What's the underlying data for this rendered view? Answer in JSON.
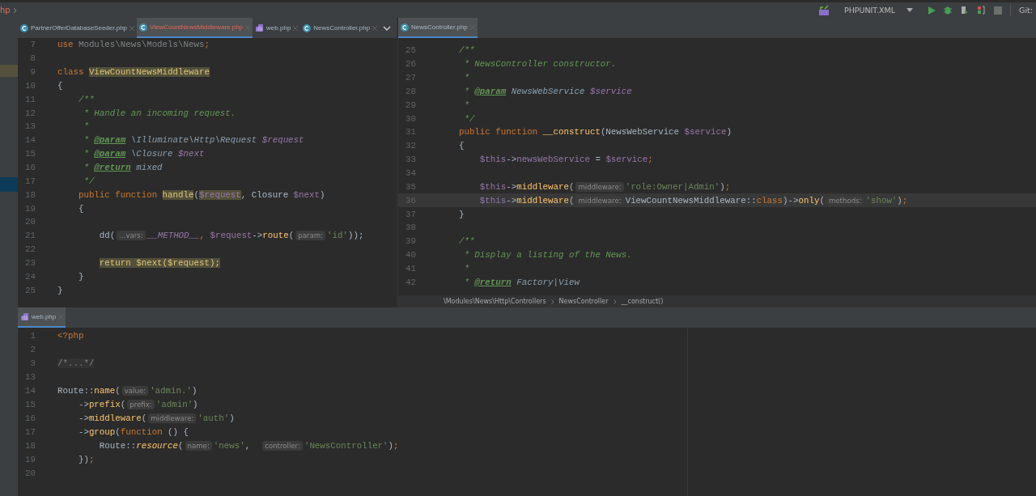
{
  "breadcrumb_top": {
    "text": "hp"
  },
  "toolbar": {
    "run_config": "PHPUNIT.XML",
    "vcs": "Git:"
  },
  "left_editor": {
    "tabs": [
      {
        "label": "PartnerOfferDatabaseSeeder.php",
        "kind": "class",
        "selected": false,
        "error": false
      },
      {
        "label": "ViewCountNewsMiddleware.php",
        "kind": "class",
        "selected": true,
        "error": true
      },
      {
        "label": "web.php",
        "kind": "routes",
        "selected": false,
        "error": false
      },
      {
        "label": "NewsController.php",
        "kind": "class",
        "selected": false,
        "error": false
      }
    ],
    "lines": [
      {
        "num": "7",
        "tokens": [
          {
            "text": "use",
            "kind": "keyword"
          },
          {
            "text": " Modules\\News\\Models\\News",
            "kind": "dim"
          },
          {
            "text": ";",
            "kind": "keyword"
          }
        ]
      },
      {
        "num": "8"
      },
      {
        "num": "9",
        "tokens": [
          {
            "text": "class ",
            "kind": "keyword"
          },
          {
            "text": "ViewCountNewsMiddleware",
            "kind": "mark"
          }
        ]
      },
      {
        "num": "10",
        "tokens": [
          {
            "text": "{",
            "kind": "plain"
          }
        ]
      },
      {
        "num": "11",
        "tokens": [
          {
            "text": "    /**",
            "kind": "comment"
          }
        ]
      },
      {
        "num": "12",
        "tokens": [
          {
            "text": "     * Handle an incoming request.",
            "kind": "comment"
          }
        ]
      },
      {
        "num": "13",
        "tokens": [
          {
            "text": "     *",
            "kind": "comment"
          }
        ]
      },
      {
        "num": "14",
        "tokens": [
          {
            "text": "     * ",
            "kind": "comment"
          },
          {
            "text": "@param",
            "kind": "tag"
          },
          {
            "text": " \\Illuminate\\Http\\Request",
            "kind": "type"
          },
          {
            "text": " $request",
            "kind": "ivar"
          }
        ]
      },
      {
        "num": "15",
        "tokens": [
          {
            "text": "     * ",
            "kind": "comment"
          },
          {
            "text": "@param",
            "kind": "tag"
          },
          {
            "text": " \\Closure",
            "kind": "type"
          },
          {
            "text": " $next",
            "kind": "ivar"
          }
        ]
      },
      {
        "num": "16",
        "tokens": [
          {
            "text": "     * ",
            "kind": "comment"
          },
          {
            "text": "@return",
            "kind": "tag"
          },
          {
            "text": " mixed",
            "kind": "type"
          }
        ]
      },
      {
        "num": "17",
        "tokens": [
          {
            "text": "     */",
            "kind": "comment"
          }
        ]
      },
      {
        "num": "18",
        "tokens": [
          {
            "text": "    public function ",
            "kind": "keyword"
          },
          {
            "text": "handle",
            "kind": "mark"
          },
          {
            "text": "(",
            "kind": "plain"
          },
          {
            "text": "$request",
            "kind": "markvar"
          },
          {
            "text": ", Closure ",
            "kind": "plain"
          },
          {
            "text": "$next",
            "kind": "var"
          },
          {
            "text": ")",
            "kind": "plain"
          }
        ]
      },
      {
        "num": "19",
        "tokens": [
          {
            "text": "    {",
            "kind": "plain"
          }
        ]
      },
      {
        "num": "20"
      },
      {
        "num": "21",
        "tokens": [
          {
            "text": "        dd(",
            "kind": "plain"
          },
          {
            "text": "...vars:",
            "kind": "hint"
          },
          {
            "text": "__METHOD__",
            "kind": "const"
          },
          {
            "text": ", ",
            "kind": "keyword"
          },
          {
            "text": "$request",
            "kind": "var"
          },
          {
            "text": "->",
            "kind": "plain"
          },
          {
            "text": "route",
            "kind": "method"
          },
          {
            "text": "(",
            "kind": "plain"
          },
          {
            "text": "param:",
            "kind": "hint"
          },
          {
            "text": "'id'",
            "kind": "string"
          },
          {
            "text": "));",
            "kind": "plain"
          }
        ]
      },
      {
        "num": "22"
      },
      {
        "num": "23",
        "tokens": [
          {
            "text": "        return $next($request);",
            "kind": "mark"
          }
        ]
      },
      {
        "num": "24",
        "tokens": [
          {
            "text": "    }",
            "kind": "plain"
          }
        ]
      },
      {
        "num": "25",
        "tokens": [
          {
            "text": "}",
            "kind": "plain"
          }
        ]
      }
    ]
  },
  "right_editor": {
    "tabs": [
      {
        "label": "NewsController.php",
        "kind": "class",
        "selected": true,
        "error": false
      }
    ],
    "lines": [
      {
        "num": "25",
        "current": false,
        "tokens": [
          {
            "text": "    /**",
            "kind": "comment"
          }
        ]
      },
      {
        "num": "26",
        "current": false,
        "tokens": [
          {
            "text": "     * NewsController constructor.",
            "kind": "comment"
          }
        ]
      },
      {
        "num": "27",
        "current": false,
        "tokens": [
          {
            "text": "     *",
            "kind": "comment"
          }
        ]
      },
      {
        "num": "28",
        "current": false,
        "tokens": [
          {
            "text": "     * ",
            "kind": "comment"
          },
          {
            "text": "@param",
            "kind": "tag"
          },
          {
            "text": " NewsWebService",
            "kind": "type"
          },
          {
            "text": " $service",
            "kind": "ivar"
          }
        ]
      },
      {
        "num": "29",
        "current": false,
        "tokens": [
          {
            "text": "     *",
            "kind": "comment"
          }
        ]
      },
      {
        "num": "30",
        "current": false,
        "tokens": [
          {
            "text": "     */",
            "kind": "comment"
          }
        ]
      },
      {
        "num": "31",
        "current": false,
        "tokens": [
          {
            "text": "    public function ",
            "kind": "keyword"
          },
          {
            "text": "__construct",
            "kind": "method"
          },
          {
            "text": "(NewsWebService ",
            "kind": "plain"
          },
          {
            "text": "$service",
            "kind": "var"
          },
          {
            "text": ")",
            "kind": "plain"
          }
        ]
      },
      {
        "num": "32",
        "current": false,
        "tokens": [
          {
            "text": "    {",
            "kind": "plain"
          }
        ]
      },
      {
        "num": "33",
        "current": false,
        "tokens": [
          {
            "text": "        $this",
            "kind": "var"
          },
          {
            "text": "->",
            "kind": "plain"
          },
          {
            "text": "newsWebService",
            "kind": "var"
          },
          {
            "text": " = ",
            "kind": "plain"
          },
          {
            "text": "$service",
            "kind": "var"
          },
          {
            "text": ";",
            "kind": "keyword"
          }
        ]
      },
      {
        "num": "34",
        "current": false
      },
      {
        "num": "35",
        "current": false,
        "tokens": [
          {
            "text": "        $this",
            "kind": "var"
          },
          {
            "text": "->",
            "kind": "plain"
          },
          {
            "text": "middleware",
            "kind": "method"
          },
          {
            "text": "(",
            "kind": "plain"
          },
          {
            "text": "middleware:",
            "kind": "hint"
          },
          {
            "text": "'role:Owner|Admin'",
            "kind": "string"
          },
          {
            "text": ")",
            "kind": "plain"
          },
          {
            "text": ";",
            "kind": "keyword"
          }
        ]
      },
      {
        "num": "36",
        "current": true,
        "tokens": [
          {
            "text": "        $this",
            "kind": "var"
          },
          {
            "text": "->",
            "kind": "plain"
          },
          {
            "text": "middleware",
            "kind": "method"
          },
          {
            "text": "(",
            "kind": "plain"
          },
          {
            "text": "middleware:",
            "kind": "hint"
          },
          {
            "text": "ViewCountNewsMiddleware::",
            "kind": "plain"
          },
          {
            "text": "class",
            "kind": "keyword"
          },
          {
            "text": ")->",
            "kind": "plain"
          },
          {
            "text": "only",
            "kind": "method"
          },
          {
            "text": "(",
            "kind": "plain"
          },
          {
            "text": "methods:",
            "kind": "hint"
          },
          {
            "text": "'show'",
            "kind": "string"
          },
          {
            "text": ")",
            "kind": "plain"
          },
          {
            "text": ";",
            "kind": "keyword"
          }
        ]
      },
      {
        "num": "37",
        "current": false,
        "tokens": [
          {
            "text": "    }",
            "kind": "plain"
          }
        ]
      },
      {
        "num": "38",
        "current": false
      },
      {
        "num": "39",
        "current": false,
        "tokens": [
          {
            "text": "    /**",
            "kind": "comment"
          }
        ]
      },
      {
        "num": "40",
        "current": false,
        "tokens": [
          {
            "text": "     * Display a listing of the News.",
            "kind": "comment"
          }
        ]
      },
      {
        "num": "41",
        "current": false,
        "tokens": [
          {
            "text": "     *",
            "kind": "comment"
          }
        ]
      },
      {
        "num": "42",
        "current": false,
        "tokens": [
          {
            "text": "     * ",
            "kind": "comment"
          },
          {
            "text": "@return",
            "kind": "tag"
          },
          {
            "text": " Factory|View",
            "kind": "type"
          }
        ]
      }
    ],
    "breadcrumbs": [
      "\\Modules\\News\\Http\\Controllers",
      "NewsController",
      "__construct()"
    ]
  },
  "bottom_editor": {
    "tabs": [
      {
        "label": "web.php",
        "kind": "routes",
        "selected": true,
        "error": false
      }
    ],
    "lines": [
      {
        "num": "1",
        "tokens": [
          {
            "text": "<?php",
            "kind": "keyword"
          }
        ]
      },
      {
        "num": "2"
      },
      {
        "num": "3",
        "tokens": [
          {
            "text": "/*...*/",
            "kind": "fold"
          }
        ]
      },
      {
        "num": "13"
      },
      {
        "num": "14",
        "tokens": [
          {
            "text": "Route::",
            "kind": "plain"
          },
          {
            "text": "name",
            "kind": "method"
          },
          {
            "text": "(",
            "kind": "plain"
          },
          {
            "text": "value:",
            "kind": "hint"
          },
          {
            "text": "'admin.'",
            "kind": "string"
          },
          {
            "text": ")",
            "kind": "plain"
          }
        ]
      },
      {
        "num": "15",
        "tokens": [
          {
            "text": "    ->",
            "kind": "plain"
          },
          {
            "text": "prefix",
            "kind": "method"
          },
          {
            "text": "(",
            "kind": "plain"
          },
          {
            "text": "prefix:",
            "kind": "hint"
          },
          {
            "text": "'admin'",
            "kind": "string"
          },
          {
            "text": ")",
            "kind": "plain"
          }
        ]
      },
      {
        "num": "16",
        "tokens": [
          {
            "text": "    ->",
            "kind": "plain"
          },
          {
            "text": "middleware",
            "kind": "method"
          },
          {
            "text": "(",
            "kind": "plain"
          },
          {
            "text": "middleware:",
            "kind": "hint"
          },
          {
            "text": "'auth'",
            "kind": "string"
          },
          {
            "text": ")",
            "kind": "plain"
          }
        ]
      },
      {
        "num": "17",
        "tokens": [
          {
            "text": "    ->",
            "kind": "plain"
          },
          {
            "text": "group",
            "kind": "method"
          },
          {
            "text": "(",
            "kind": "plain"
          },
          {
            "text": "function ",
            "kind": "keyword"
          },
          {
            "text": "() {",
            "kind": "plain"
          }
        ]
      },
      {
        "num": "18",
        "tokens": [
          {
            "text": "        Route::",
            "kind": "plain"
          },
          {
            "text": "resource",
            "kind": "static"
          },
          {
            "text": "(",
            "kind": "plain"
          },
          {
            "text": "name:",
            "kind": "hint"
          },
          {
            "text": "'news'",
            "kind": "string"
          },
          {
            "text": ",  ",
            "kind": "plain"
          },
          {
            "text": "controller:",
            "kind": "hint"
          },
          {
            "text": "'NewsController'",
            "kind": "string"
          },
          {
            "text": ")",
            "kind": "plain"
          },
          {
            "text": ";",
            "kind": "keyword"
          }
        ]
      },
      {
        "num": "19",
        "tokens": [
          {
            "text": "    })",
            "kind": "plain"
          },
          {
            "text": ";",
            "kind": "keyword"
          }
        ]
      },
      {
        "num": "20"
      }
    ]
  }
}
